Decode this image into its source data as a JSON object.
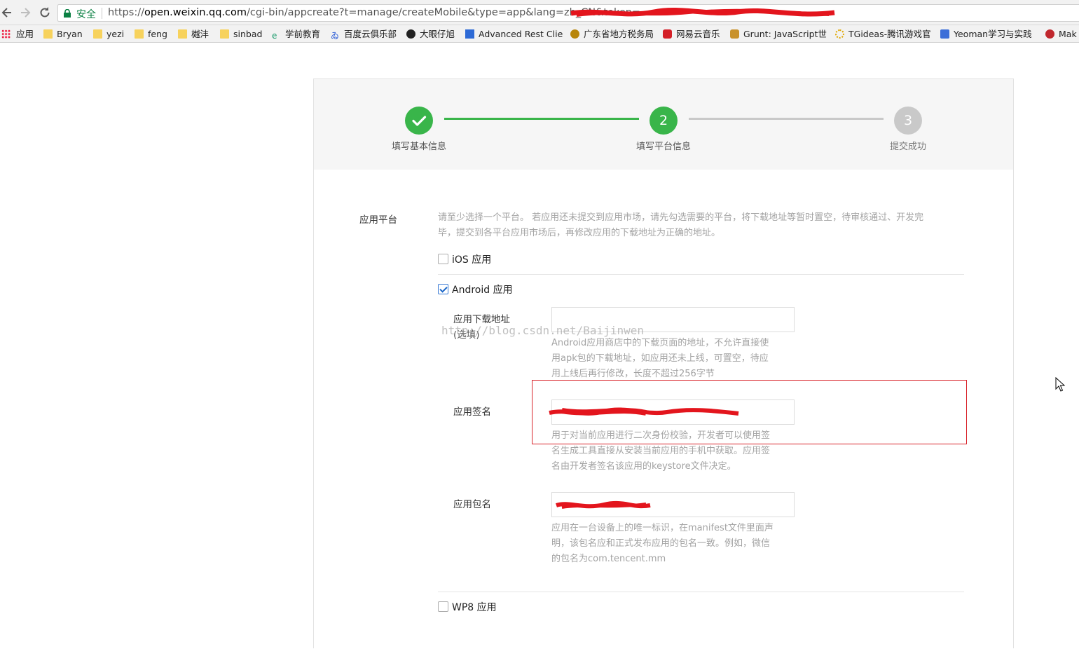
{
  "browser": {
    "secure_label": "安全",
    "url_prefix": "https://",
    "url_host": "open.weixin.qq.com",
    "url_path": "/cgi-bin/appcreate?t=manage/createMobile&type=app&lang=zh_CN&token="
  },
  "bookmarks": [
    {
      "label": "应用",
      "icon": "apps-grid-icon"
    },
    {
      "label": "Bryan",
      "icon": "folder-icon"
    },
    {
      "label": "yezi",
      "icon": "folder-icon"
    },
    {
      "label": "feng",
      "icon": "folder-icon"
    },
    {
      "label": "樾沣",
      "icon": "folder-icon"
    },
    {
      "label": "sinbad",
      "icon": "folder-icon"
    },
    {
      "label": "学前教育",
      "icon": "site-e-icon"
    },
    {
      "label": "百度云俱乐部",
      "icon": "baidu-icon"
    },
    {
      "label": "大眼仔旭",
      "icon": "eye-icon"
    },
    {
      "label": "Advanced Rest Clie",
      "icon": "arc-icon"
    },
    {
      "label": "广东省地方税务局",
      "icon": "tax-emblem-icon"
    },
    {
      "label": "网易云音乐",
      "icon": "netease-music-icon"
    },
    {
      "label": "Grunt: JavaScript世",
      "icon": "grunt-icon"
    },
    {
      "label": "TGideas-腾讯游戏官",
      "icon": "tgideas-icon"
    },
    {
      "label": "Yeoman学习与实践",
      "icon": "yeoman-icon"
    },
    {
      "label": "Mak",
      "icon": "mak-icon"
    }
  ],
  "steps": [
    {
      "number": "✓",
      "label": "填写基本信息",
      "state": "done"
    },
    {
      "number": "2",
      "label": "填写平台信息",
      "state": "current"
    },
    {
      "number": "3",
      "label": "提交成功",
      "state": "pending"
    }
  ],
  "colors": {
    "green": "#39b54a",
    "gray": "#c9c9c9",
    "accent_red": "#d8232a"
  },
  "form": {
    "platform_label": "应用平台",
    "platform_hint_line1": "请至少选择一个平台。 若应用还未提交到应用市场，请先勾选需要的平台，将下载地址等暂时置空，待审核通过、开发完",
    "platform_hint_line2": "毕，提交到各平台应用市场后，再修改应用的下载地址为正确的地址。",
    "ios_label": "iOS 应用",
    "ios_checked": false,
    "android_label": "Android 应用",
    "android_checked": true,
    "download_label_line1": "应用下载地址",
    "download_label_line2": "(选填)",
    "download_value": "",
    "download_hint_line1": "Android应用商店中的下载页面的地址，不允许直接使",
    "download_hint_line2": "用apk包的下载地址，如应用还未上线，可置空，待应",
    "download_hint_line3": "用上线后再行修改，长度不超过256字节",
    "signature_label": "应用签名",
    "signature_hint_line1": "用于对当前应用进行二次身份校验，开发者可以使用签",
    "signature_hint_line2": "名生成工具直接从安装当前应用的手机中获取。应用签",
    "signature_hint_line3": "名由开发者签名该应用的keystore文件决定。",
    "package_label": "应用包名",
    "package_hint_line1": "应用在一台设备上的唯一标识，在manifest文件里面声",
    "package_hint_line2": "明，该包名应和正式发布应用的包名一致。例如，微信",
    "package_hint_line3": "的包名为com.tencent.mm",
    "wp8_label": "WP8 应用",
    "wp8_checked": false
  },
  "watermark": "http://blog.csdn.net/Baijinwen"
}
